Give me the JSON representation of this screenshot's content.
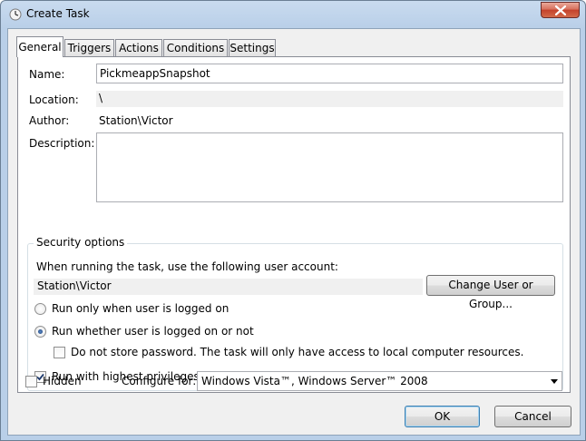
{
  "window": {
    "title": "Create Task"
  },
  "tabs": [
    {
      "label": "General"
    },
    {
      "label": "Triggers"
    },
    {
      "label": "Actions"
    },
    {
      "label": "Conditions"
    },
    {
      "label": "Settings"
    }
  ],
  "general": {
    "name_label": "Name:",
    "name_value": "PickmeappSnapshot",
    "location_label": "Location:",
    "location_value": "\\",
    "author_label": "Author:",
    "author_value": "Station\\Victor",
    "description_label": "Description:",
    "description_value": ""
  },
  "security": {
    "legend": "Security options",
    "account_prompt": "When running the task, use the following user account:",
    "account_value": "Station\\Victor",
    "change_button": "Change User or Group...",
    "radio_logged_on": "Run only when user is logged on",
    "radio_whether": "Run whether user is logged on or not",
    "no_store_password": "Do not store password.  The task will only have access to local computer resources.",
    "highest_privileges": "Run with highest privileges"
  },
  "bottom": {
    "hidden_label": "Hidden",
    "configure_label": "Configure for:",
    "configure_value": "Windows Vista™, Windows Server™ 2008",
    "ok_button": "OK",
    "cancel_button": "Cancel"
  }
}
